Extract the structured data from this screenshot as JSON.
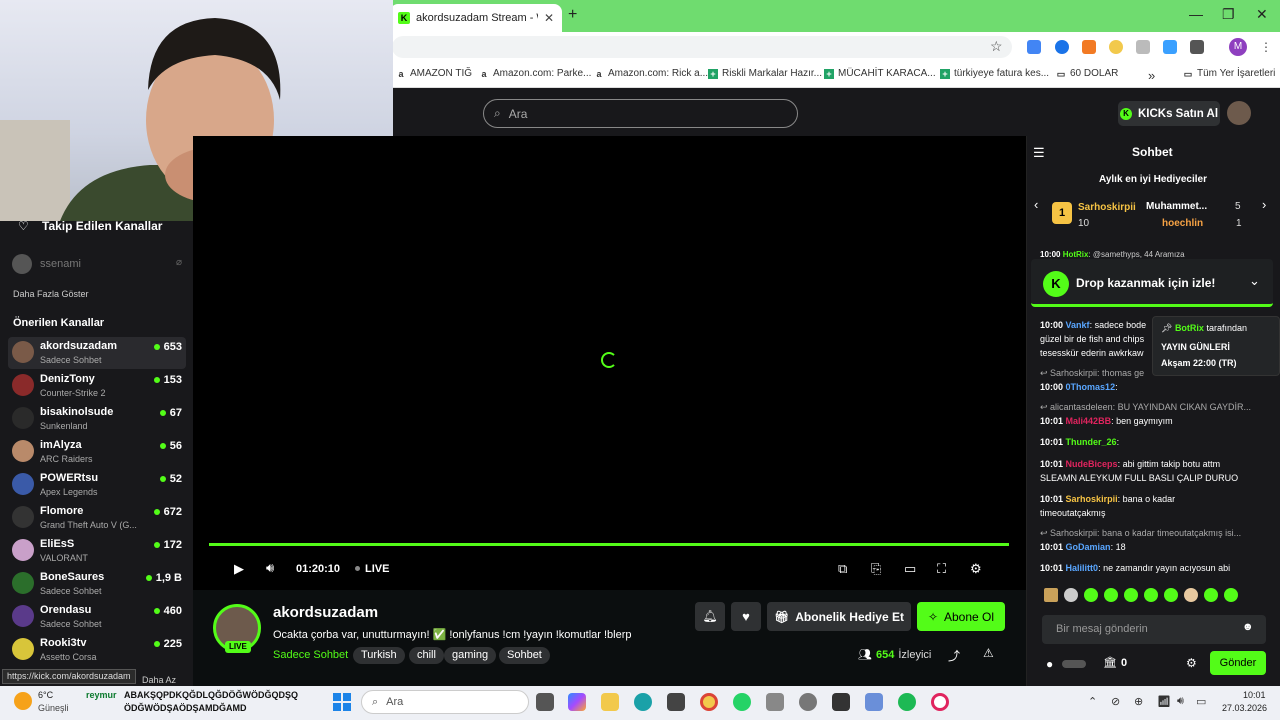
{
  "browser": {
    "tab_title": "akordsuzadam Stream - Watch",
    "tab_favicon": "K",
    "new_tab": "+",
    "profile_initial": "M",
    "bookmarks": [
      {
        "label": "AMAZON TIĞ",
        "icon": "a"
      },
      {
        "label": "Amazon.com: Parke...",
        "icon": "a"
      },
      {
        "label": "Amazon.com: Rick a...",
        "icon": "a"
      },
      {
        "label": "Riskli Markalar Hazır...",
        "icon": "+"
      },
      {
        "label": "MÜCAHİT KARACA...",
        "icon": "+"
      },
      {
        "label": "türkiyeye fatura kes...",
        "icon": "+"
      },
      {
        "label": "60 DOLAR",
        "icon": "folder"
      }
    ],
    "bookmarks_more": "»",
    "all_bookmarks": "Tüm Yer İşaretleri"
  },
  "header": {
    "search_placeholder": "Ara",
    "kicks_button": "KICKs Satın Al"
  },
  "sidebar": {
    "followed_title": "Takip Edilen Kanallar",
    "offline_channel": "ssenami",
    "show_more": "Daha Fazla Göster",
    "recommended_title": "Önerilen Kanallar",
    "show_less": "Daha Az",
    "channels": [
      {
        "name": "akordsuzadam",
        "category": "Sadece Sohbet",
        "viewers": "653",
        "avatar": "#7a5a48"
      },
      {
        "name": "DenizTony",
        "category": "Counter-Strike 2",
        "viewers": "153",
        "avatar": "#8a2a2a"
      },
      {
        "name": "bisakinolsude",
        "category": "Sunkenland",
        "viewers": "67",
        "avatar": "#2a2a2a"
      },
      {
        "name": "imAlyza",
        "category": "ARC Raiders",
        "viewers": "56",
        "avatar": "#b98a6a"
      },
      {
        "name": "POWERtsu",
        "category": "Apex Legends",
        "viewers": "52",
        "avatar": "#3a5aa8"
      },
      {
        "name": "Flomore",
        "category": "Grand Theft Auto V (G...",
        "viewers": "672",
        "avatar": "#333"
      },
      {
        "name": "EliEsS",
        "category": "VALORANT",
        "viewers": "172",
        "avatar": "#c9a0c9"
      },
      {
        "name": "BoneSaures",
        "category": "Sadece Sohbet",
        "viewers": "1,9 B",
        "avatar": "#2b6e2b"
      },
      {
        "name": "Orendasu",
        "category": "Sadece Sohbet",
        "viewers": "460",
        "avatar": "#5a3a8a"
      },
      {
        "name": "Rooki3tv",
        "category": "Assetto Corsa",
        "viewers": "225",
        "avatar": "#d8c53a"
      }
    ]
  },
  "player": {
    "time": "01:20:10",
    "live": "LIVE"
  },
  "stream": {
    "channel": "akordsuzadam",
    "badge": "LIVE",
    "title": "Ocakta çorba var, unutturmayın! ✅ !onlyfanus !cm !yayın  !komutlar !blerp",
    "category": "Sadece Sohbet",
    "tags": [
      "Turkish",
      "chill",
      "gaming",
      "Sohbet"
    ],
    "gift_button": "Abonelik Hediye Et",
    "subscribe_button": "Abone Ol",
    "viewers": "654",
    "viewers_label": "İzleyici"
  },
  "chat": {
    "title": "Sohbet",
    "gifters_title": "Aylık en iyi Hediyeciler",
    "gifter1": {
      "rank": "1",
      "name": "Sarhoskirpii",
      "count": "10"
    },
    "gifter2": {
      "name": "Muhammet...",
      "count": "5"
    },
    "gifter3": {
      "name": "hoechlin",
      "count": "1"
    },
    "ticker": "10:00 ",
    "ticker_user": "HotRix",
    "ticker_text": ": @samethyps, 44 Aramıza",
    "drop_banner": "Drop kazanmak için izle!",
    "pinned": {
      "by": "BotRix",
      "by_suffix": "tarafından",
      "line1": "YAYIN GÜNLERİ",
      "line2": "Akşam 22:00 (TR)"
    },
    "messages": [
      {
        "time": "10:00",
        "user": "Vankf",
        "color": "#59a6ff",
        "text": ": sadece bode"
      },
      {
        "time": "",
        "user": "",
        "color": "#fff",
        "text": "güzel bir de fish and chips"
      },
      {
        "time": "",
        "user": "",
        "color": "#fff",
        "text": "tesesskür ederin awkrkaw"
      },
      {
        "time": "",
        "user": "",
        "color": "#aaa",
        "text": "↩ Sarhoskirpii: thomas ge"
      },
      {
        "time": "10:00",
        "user": "0Thomas12",
        "color": "#59a6ff",
        "text": ":"
      },
      {
        "time": "",
        "user": "",
        "color": "#aaa",
        "text": "↩ alicantasdeleen: BU YAYINDAN CIKAN GAYDİR..."
      },
      {
        "time": "10:01",
        "user": "Mali442BB",
        "color": "#e0245e",
        "text": ": ben gaymıyım"
      },
      {
        "time": "10:01",
        "user": "Thunder_26",
        "color": "#53fc18",
        "text": ":"
      },
      {
        "time": "10:01",
        "user": "NudeBiceps",
        "color": "#e0245e",
        "text": ": abi gittim takip botu attm"
      },
      {
        "time": "",
        "user": "",
        "color": "#fff",
        "text": "SLEAMN ALEYKUM FULL BASLI ÇALIP DURUO"
      },
      {
        "time": "10:01",
        "user": "Sarhoskirpii",
        "color": "#f6c344",
        "text": ": bana o kadar"
      },
      {
        "time": "",
        "user": "",
        "color": "#fff",
        "text": "timeoutatçakmış"
      },
      {
        "time": "",
        "user": "",
        "color": "#aaa",
        "text": "↩ Sarhoskirpii: bana o kadar timeoutatçakmış isi..."
      },
      {
        "time": "10:01",
        "user": "GoDamian",
        "color": "#59a6ff",
        "text": ": 18"
      },
      {
        "time": "10:01",
        "user": "Halilitt0",
        "color": "#59a6ff",
        "text": ": ne zamandır yayın acıyosun abi"
      }
    ],
    "input_placeholder": "Bir mesaj gönderin",
    "points": "0",
    "send_button": "Gönder"
  },
  "status_url": "https://kick.com/akordsuzadam",
  "taskbar": {
    "weather_temp": "6°C",
    "weather_loc": "Güneşli",
    "user_tag": "reymur",
    "marquee1": "ABAKŞQPDKQĞDLQĞDÖĞWÖDĞQDŞQ",
    "marquee2": "ÖDĞWÖDŞAÖDŞAMDĞAMD",
    "search": "Ara",
    "time": "10:01",
    "date": "27.03.2026"
  },
  "colors": {
    "accent": "#53fc18",
    "dark": "#18181b"
  }
}
